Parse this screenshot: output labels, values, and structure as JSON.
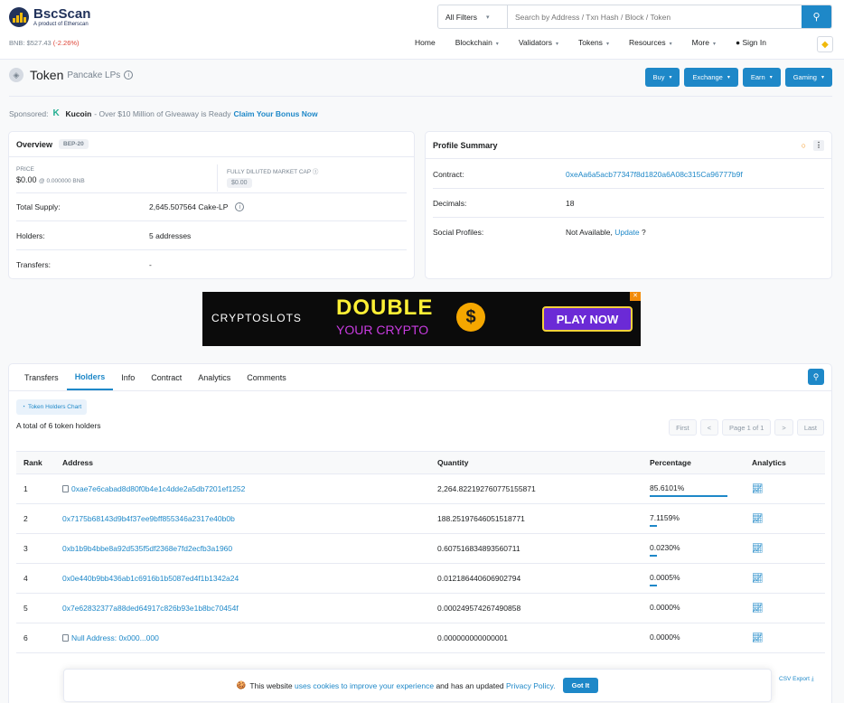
{
  "header": {
    "logo_name": "BscScan",
    "logo_sub": "A product of Etherscan",
    "bnb_label": "BNB: $527.43",
    "bnb_change": "(-2.26%)",
    "filter_label": "All Filters",
    "search_placeholder": "Search by Address / Txn Hash / Block / Token",
    "nav": {
      "home": "Home",
      "blockchain": "Blockchain",
      "validators": "Validators",
      "tokens": "Tokens",
      "resources": "Resources",
      "more": "More",
      "signin": "Sign In"
    }
  },
  "title": {
    "main": "Token",
    "sub": "Pancake LPs",
    "buttons": {
      "buy": "Buy",
      "exchange": "Exchange",
      "earn": "Earn",
      "gaming": "Gaming"
    }
  },
  "sponsor": {
    "prefix": "Sponsored:",
    "brand": "Kucoin",
    "text": "- Over $10 Million of Giveaway is Ready",
    "cta": "Claim Your Bonus Now"
  },
  "overview": {
    "title": "Overview",
    "badge": "BEP-20",
    "price_label": "PRICE",
    "price_value": "$0.00",
    "price_bnb": "@ 0.000000 BNB",
    "fdmc_label": "FULLY DILUTED MARKET CAP",
    "fdmc_value": "$0.00",
    "supply_label": "Total Supply:",
    "supply_value": "2,645.507564 Cake-LP",
    "holders_label": "Holders:",
    "holders_value": "5 addresses",
    "transfers_label": "Transfers:",
    "transfers_value": "-"
  },
  "profile": {
    "title": "Profile Summary",
    "contract_label": "Contract:",
    "contract_value": "0xeAa6a5acb77347f8d1820a6A08c315Ca96777b9f",
    "decimals_label": "Decimals:",
    "decimals_value": "18",
    "social_label": "Social Profiles:",
    "social_value": "Not Available,",
    "social_link": "Update",
    "social_q": "?"
  },
  "ad": {
    "brand": "CRYPTOSLOTS",
    "headline": "DOUBLE",
    "subline": "YOUR CRYPTO",
    "coin": "$",
    "cta": "PLAY NOW"
  },
  "tabs": [
    "Transfers",
    "Holders",
    "Info",
    "Contract",
    "Analytics",
    "Comments"
  ],
  "holders": {
    "chart_btn": "Token Holders Chart",
    "total_text": "A total of 6 token holders",
    "pager": {
      "first": "First",
      "prev": "<",
      "page": "Page 1 of 1",
      "next": ">",
      "last": "Last"
    },
    "columns": [
      "Rank",
      "Address",
      "Quantity",
      "Percentage",
      "Analytics"
    ],
    "rows": [
      {
        "rank": "1",
        "address": "0xae7e6cabad8d80f0b4e1c4dde2a5db7201ef1252",
        "contract": true,
        "quantity": "2,264.822192760775155871",
        "percentage": "85.6101%",
        "pct": 85.6101
      },
      {
        "rank": "2",
        "address": "0x7175b68143d9b4f37ee9bff855346a2317e40b0b",
        "contract": false,
        "quantity": "188.25197646051518771",
        "percentage": "7.1159%",
        "pct": 7.1159
      },
      {
        "rank": "3",
        "address": "0xb1b9b4bbe8a92d535f5df2368e7fd2ecfb3a1960",
        "contract": false,
        "quantity": "0.607516834893560711",
        "percentage": "0.0230%",
        "pct": 0.023
      },
      {
        "rank": "4",
        "address": "0x0e440b9bb436ab1c6916b1b5087ed4f1b1342a24",
        "contract": false,
        "quantity": "0.012186440606902794",
        "percentage": "0.0005%",
        "pct": 0.0005
      },
      {
        "rank": "5",
        "address": "0x7e62832377a88ded64917c826b93e1b8bc70454f",
        "contract": false,
        "quantity": "0.000249574267490858",
        "percentage": "0.0000%",
        "pct": 0
      },
      {
        "rank": "6",
        "address": "Null Address: 0x000...000",
        "contract": true,
        "quantity": "0.000000000000001",
        "percentage": "0.0000%",
        "pct": 0
      }
    ]
  },
  "cookie": {
    "emoji": "🍪",
    "pre": "This website",
    "link1": "uses cookies to improve your experience",
    "mid": "and has an updated",
    "link2": "Privacy Policy.",
    "btn": "Got It"
  },
  "csv": "CSV Export"
}
